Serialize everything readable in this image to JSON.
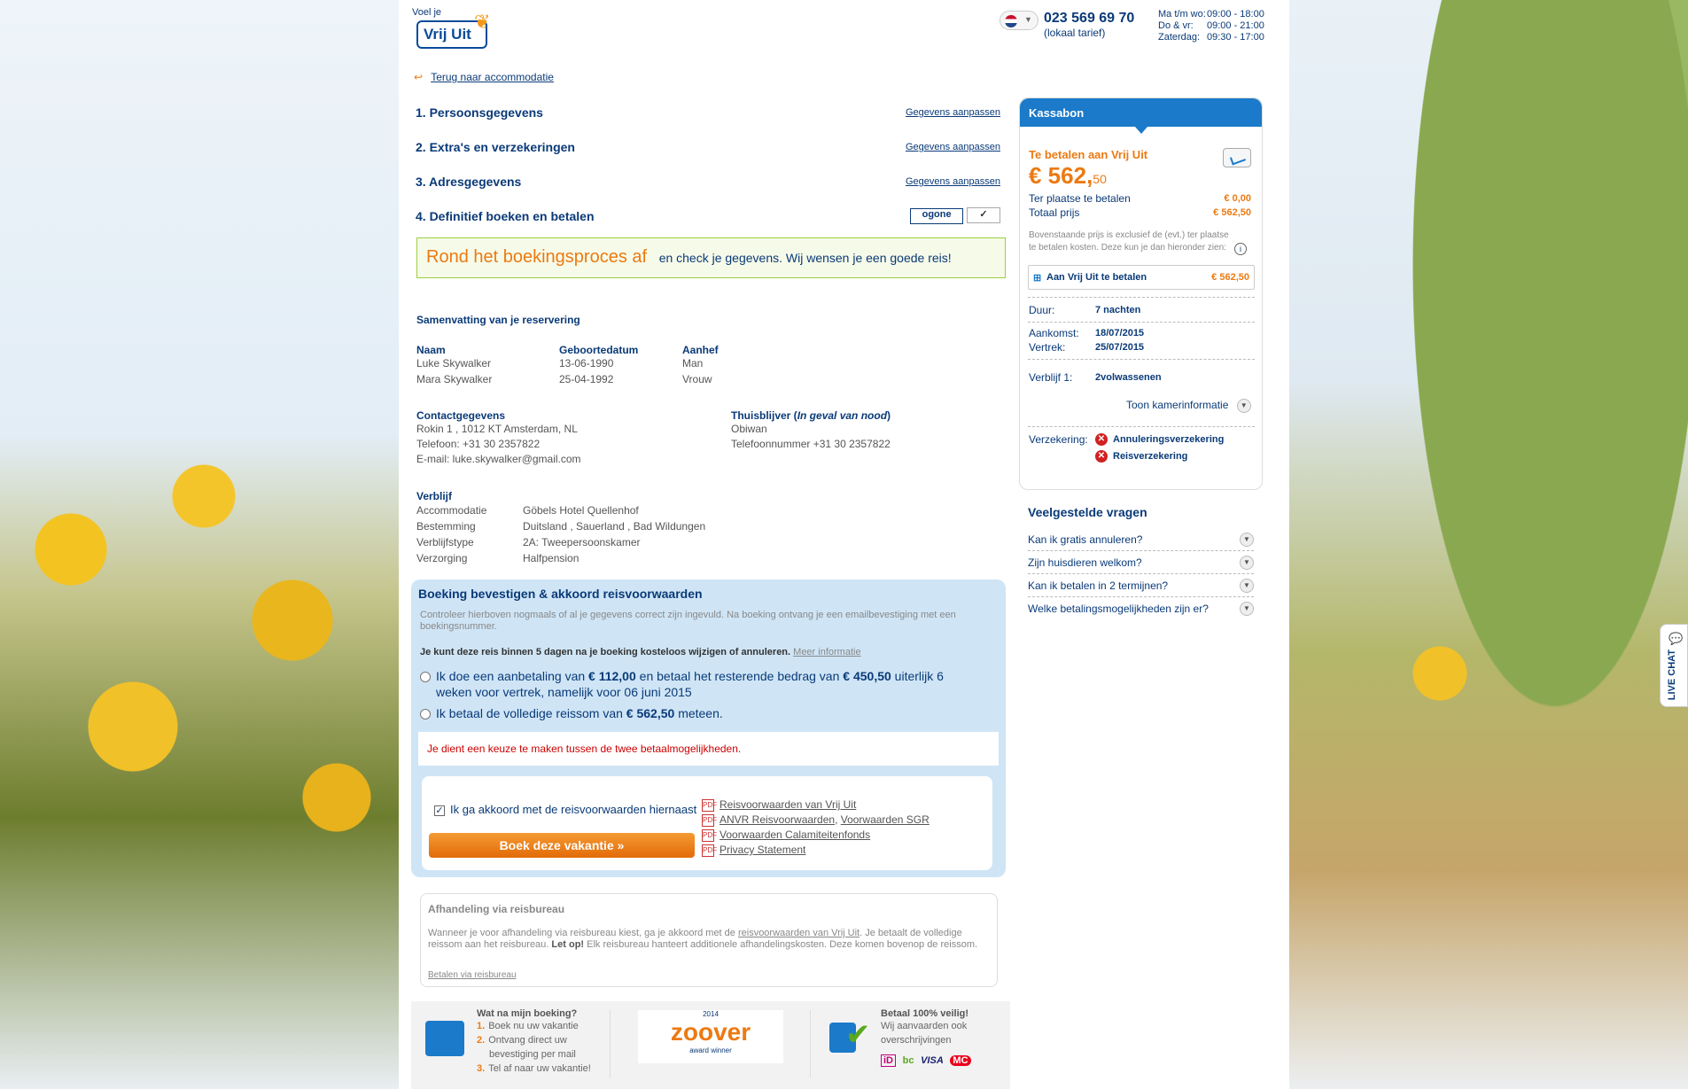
{
  "header": {
    "logo_tag": "Voel je",
    "logo_text": "Vrij Uit",
    "phone": "023 569 69 70",
    "phone_sub": "(lokaal tarief)",
    "hours": [
      {
        "day": "Ma t/m wo:",
        "time": "09:00 - 18:00"
      },
      {
        "day": "Do & vr:",
        "time": "09:00 - 21:00"
      },
      {
        "day": "Zaterdag:",
        "time": "09:30 - 17:00"
      }
    ],
    "back_link": "Terug naar accommodatie"
  },
  "steps": [
    {
      "label": "1. Persoonsgegevens",
      "edit": "Gegevens aanpassen"
    },
    {
      "label": "2. Extra's en verzekeringen",
      "edit": "Gegevens aanpassen"
    },
    {
      "label": "3. Adresgegevens",
      "edit": "Gegevens aanpassen"
    },
    {
      "label": "4. Definitief boeken en betalen",
      "badge1": "ogone",
      "badge2": "✓"
    }
  ],
  "finish": {
    "big": "Rond het boekingsproces af",
    "small": "en check je gegevens. Wij wensen je een goede reis!"
  },
  "summary": {
    "title": "Samenvatting van je reservering",
    "cols": [
      "Naam",
      "Geboortedatum",
      "Aanhef"
    ],
    "rows": [
      [
        "Luke Skywalker",
        "13-06-1990",
        "Man"
      ],
      [
        "Mara Skywalker",
        "25-04-1992",
        "Vrouw"
      ]
    ],
    "contact_title": "Contactgegevens",
    "contact": [
      "Rokin 1 , 1012 KT Amsterdam, NL",
      "Telefoon: +31 30 2357822",
      "E-mail: luke.skywalker@gmail.com"
    ],
    "home_title": "Thuisblijver (",
    "home_title_em": "In geval van nood",
    "home_title_end": ")",
    "home": [
      "Obiwan",
      "Telefoonnummer +31 30 2357822"
    ],
    "stay_title": "Verblijf",
    "stay": [
      [
        "Accommodatie",
        "Göbels Hotel Quellenhof"
      ],
      [
        "Bestemming",
        "Duitsland , Sauerland , Bad Wildungen"
      ],
      [
        "Verblijfstype",
        "2A: Tweepersoonskamer"
      ],
      [
        "Verzorging",
        "Halfpension"
      ]
    ]
  },
  "confirm": {
    "title": "Boeking bevestigen & akkoord reisvoorwaarden",
    "intro": "Controleer hierboven nogmaals of al je gegevens correct zijn ingevuld. Na boeking ontvang je een emailbevestiging met een boekingsnummer.",
    "days": "Je kunt deze reis binnen 5 dagen na je boeking kosteloos wijzigen of annuleren.",
    "more": "Meer informatie",
    "opt1_a": "Ik doe een aanbetaling van",
    "opt1_b": "€ 112,00",
    "opt1_c": "en betaal het resterende bedrag van",
    "opt1_d": "€ 450,50",
    "opt1_e": "uiterlijk 6",
    "opt1_f": "weken voor vertrek, namelijk voor",
    "opt1_g": "06 juni 2015",
    "opt2_a": "Ik betaal de volledige reissom van",
    "opt2_b": "€ 562,50",
    "opt2_c": "meteen.",
    "warn": "Je dient een keuze te maken tussen de twee betaalmogelijkheden.",
    "agree": "Ik ga akkoord met de reisvoorwaarden hiernaast",
    "button": "Boek deze vakantie",
    "docs": [
      "Reisvoorwaarden van Vrij Uit",
      "ANVR Reisvoorwaarden",
      "Voorwaarden SGR",
      "Voorwaarden Calamiteitenfonds",
      "Privacy Statement"
    ]
  },
  "agency": {
    "title": "Afhandeling via reisbureau",
    "p1": "Wanneer je voor afhandeling via reisbureau kiest, ga je akkoord met de",
    "p_link": "reisvoorwaarden van Vrij Uit",
    "p2": ". Je betaalt de volledige reissom aan het reisbureau.",
    "p_bold": "Let op!",
    "p3": "Elk reisbureau hanteert additionele afhandelingskosten. Deze komen bovenop de reissom.",
    "link": "Betalen via reisbureau"
  },
  "footer": {
    "what_title": "Wat na mijn boeking?",
    "what": [
      {
        "n": "1.",
        "t": "Boek nu uw vakantie"
      },
      {
        "n": "2.",
        "t": "Ontvang direct uw"
      },
      {
        "n": "",
        "t": "bevestiging per mail"
      },
      {
        "n": "3.",
        "t": "Tel af naar uw vakantie!"
      }
    ],
    "zoover_year": "2014",
    "zoover": "zoover",
    "zoover_sub": "award winner",
    "safe_title": "Betaal 100% veilig!",
    "safe_1": "Wij aanvaarden ook",
    "safe_2": "overschrijvingen",
    "pay": [
      "iD",
      "bc",
      "VISA",
      "MC"
    ]
  },
  "kassa": {
    "title": "Kassabon",
    "pay_title": "Te betalen aan Vrij Uit",
    "amount_main": "€ 562,",
    "amount_cents": "50",
    "local_label": "Ter plaatse te betalen",
    "local_value": "€ 0,00",
    "total_label": "Totaal prijs",
    "total_value": "€ 562,50",
    "note": "Bovenstaande prijs is exclusief de (evt.) ter plaatse te betalen kosten. Deze kun je dan hieronder zien:",
    "box_label": "Aan Vrij Uit te betalen",
    "box_value": "€ 562,50",
    "duur_label": "Duur:",
    "duur": "7 nachten",
    "aankomst_label": "Aankomst:",
    "aankomst": "18/07/2015",
    "vertrek_label": "Vertrek:",
    "vertrek": "25/07/2015",
    "verblijf_label": "Verblijf 1:",
    "verblijf": "2volwassenen",
    "room_info": "Toon kamerinformatie",
    "ins_label": "Verzekering:",
    "ins": [
      "Annuleringsverzekering",
      "Reisverzekering"
    ]
  },
  "faq": {
    "title": "Veelgestelde vragen",
    "items": [
      "Kan ik gratis annuleren?",
      "Zijn huisdieren welkom?",
      "Kan ik betalen in 2 termijnen?",
      "Welke betalingsmogelijkheden zijn er?"
    ]
  },
  "livechat": "LIVE CHAT",
  "colors": {
    "brand_blue": "#0a3a78",
    "accent_orange": "#ec7a12",
    "panel_blue": "#cfe5f6"
  }
}
